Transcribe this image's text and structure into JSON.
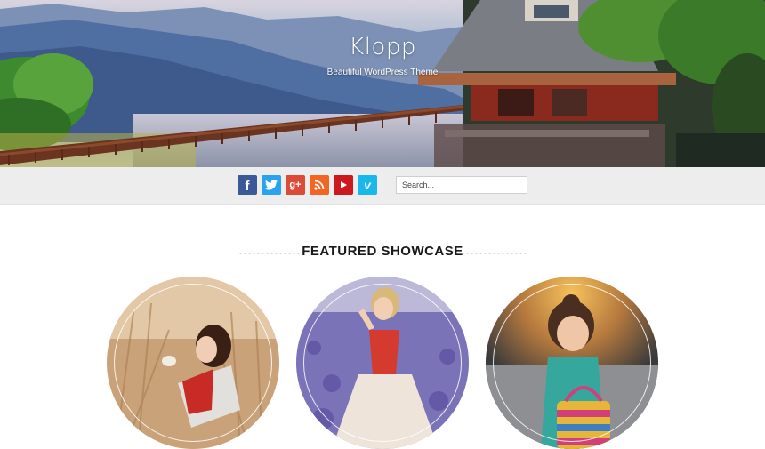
{
  "header": {
    "site_title": "Klopp",
    "tagline": "Beautiful WordPress Theme"
  },
  "social": [
    {
      "name": "facebook",
      "glyph": "f",
      "color": "#3b5998"
    },
    {
      "name": "twitter",
      "glyph": "t",
      "color": "#2aa3ef"
    },
    {
      "name": "google-plus",
      "glyph": "g+",
      "color": "#dc4a38"
    },
    {
      "name": "rss",
      "glyph": "rss",
      "color": "#f26522"
    },
    {
      "name": "youtube",
      "glyph": "▶",
      "color": "#cc181e"
    },
    {
      "name": "vimeo",
      "glyph": "v",
      "color": "#1ab7ea"
    }
  ],
  "search": {
    "placeholder": "Search..."
  },
  "featured": {
    "title": "FEATURED SHOWCASE",
    "items": [
      {
        "name": "showcase-woman-wheat-field"
      },
      {
        "name": "showcase-woman-lavender-field"
      },
      {
        "name": "showcase-girl-with-bag"
      }
    ]
  }
}
